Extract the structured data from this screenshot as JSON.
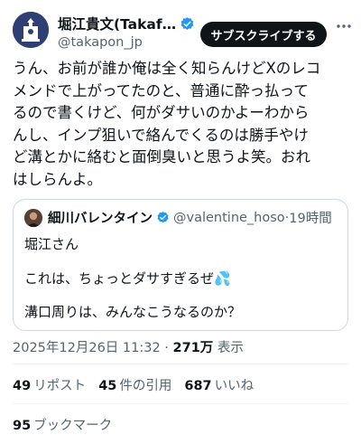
{
  "author": {
    "display_name": "堀江貴文(Takaf…",
    "handle": "@takapon_jp",
    "avatar_icon": "author-avatar-emblem",
    "verified_icon": "verified-badge-icon",
    "verified_color": "#1d9bf0"
  },
  "subscribe_button": {
    "label": "サブスクライブする"
  },
  "more_icon": "more-options-icon",
  "tweet_lines": [
    "うん、お前が誰か俺は全く知らんけどXのレコ",
    "メンドで上がってたのと、普通に酔っ払って",
    "るので書くけど、何がダサいのかよーわから",
    "んし、インプ狙いで絡んでくるのは勝手やけ",
    "ど溝とかに絡むと面倒臭いと思うよ笑。おれ",
    "はしらんよ。"
  ],
  "quote": {
    "display_name": "細川バレンタイン",
    "handle": "@valentine_hoso",
    "separator": " · ",
    "time": "19時間",
    "line1": "堀江さん",
    "line2": "これは、ちょっとダサすぎるぜ💦",
    "line3": "溝口周りは、みんなこうなるのか？"
  },
  "meta": {
    "timestamp": "2025年12月26日 11:32",
    "separator": " · ",
    "views_count": "271万",
    "views_label": "表示"
  },
  "stats": {
    "reposts_count": "49",
    "reposts_label": "リポスト",
    "quotes_count": "45",
    "quotes_label": "件の引用",
    "likes_count": "687",
    "likes_label": "いいね"
  },
  "bookmarks": {
    "count": "95",
    "label": "ブックマーク"
  }
}
